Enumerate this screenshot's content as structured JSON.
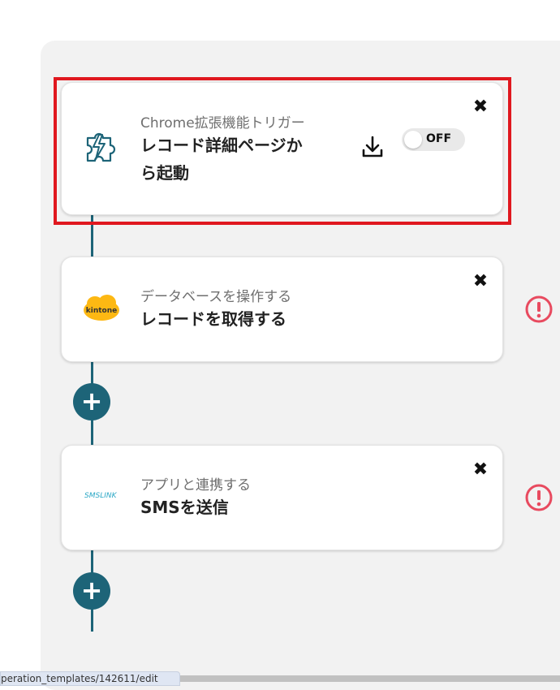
{
  "flow": {
    "steps": [
      {
        "subtitle": "Chrome拡張機能トリガー",
        "title_line1": "レコード詳細ページか",
        "title_line2": "ら起動",
        "toggle_label": "OFF",
        "icon": "puzzle-icon"
      },
      {
        "subtitle": "データベースを操作する",
        "title": "レコードを取得する",
        "logo_text": "kintone",
        "icon": "kintone-logo"
      },
      {
        "subtitle": "アプリと連携する",
        "title": "SMSを送信",
        "logo_text": "SMSLINK",
        "icon": "smslink-logo"
      }
    ],
    "close_symbol": "✖",
    "add_symbol": "+"
  },
  "status_bar": {
    "url_text": "peration_templates/142611/edit"
  },
  "colors": {
    "accent": "#1d6478",
    "highlight": "#e0181f",
    "warning": "#e84a5f",
    "kintone": "#fdb813"
  }
}
